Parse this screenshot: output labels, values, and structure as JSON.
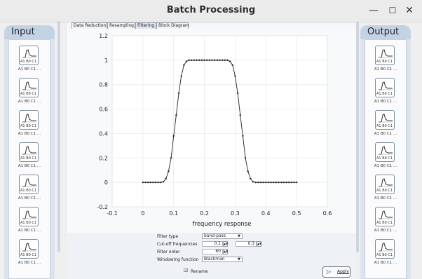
{
  "window": {
    "title": "Batch Processing",
    "minimize_glyph": "—",
    "maximize_glyph": "☐",
    "close_glyph": "✕"
  },
  "input_panel": {
    "title": "Input",
    "items": [
      {
        "icon_text": "A1 B0 C1",
        "caption": "A1 B0 C1 ..."
      },
      {
        "icon_text": "A1 B0 C1",
        "caption": "A1 B0 C1 ..."
      },
      {
        "icon_text": "A1 B0 C1",
        "caption": "A1 B0 C1 ..."
      },
      {
        "icon_text": "A1 B0 C1",
        "caption": "A1 B0 C1 ..."
      },
      {
        "icon_text": "A1 B0 C1",
        "caption": "A1 B0 C1 ..."
      },
      {
        "icon_text": "A1 B0 C1",
        "caption": "A1 B0 C1 ..."
      },
      {
        "icon_text": "A1 B0 C1",
        "caption": "A1 B0 C1 ..."
      }
    ]
  },
  "output_panel": {
    "title": "Output",
    "items": [
      {
        "icon_text": "A1 B0 C1",
        "caption": "A1 B0 C1 ..."
      },
      {
        "icon_text": "A1 B0 C1",
        "caption": "A1 B0 C1 ..."
      },
      {
        "icon_text": "A1 B0 C1",
        "caption": "A1 B0 C1 ..."
      },
      {
        "icon_text": "A1 B0 C1",
        "caption": "A1 B0 C1 ..."
      },
      {
        "icon_text": "A1 B0 C1",
        "caption": "A1 B0 C1 ..."
      },
      {
        "icon_text": "A1 B0 C1",
        "caption": "A1 B0 C1 ..."
      },
      {
        "icon_text": "A1 B0 C1",
        "caption": "A1 B0 C1 ..."
      }
    ]
  },
  "tabs": [
    {
      "label": "Data Reduction",
      "active": false
    },
    {
      "label": "Resampling",
      "active": false
    },
    {
      "label": "Filtering",
      "active": true
    },
    {
      "label": "Block Diagram",
      "active": false
    }
  ],
  "controls": {
    "filter_type_label": "Filter type",
    "filter_type_value": "band-pass",
    "cutoff_label": "Cut-off frequencies",
    "cutoff_low": "0.1",
    "cutoff_high": "0.3",
    "filter_order_label": "Filter order",
    "filter_order_value": "60",
    "windowing_label": "Windowing function",
    "windowing_value": "Blackman",
    "rename_label": "Rename",
    "rename_checked": true,
    "apply_label": "Apply"
  },
  "chart_data": {
    "type": "line",
    "title": "",
    "xlabel": "frequency response",
    "ylabel": "",
    "xlim": [
      -0.1,
      0.6
    ],
    "ylim": [
      -0.2,
      1.2
    ],
    "xticks": [
      "-0.1",
      "0",
      "0.1",
      "0.2",
      "0.3",
      "0.4",
      "0.5",
      "0.6"
    ],
    "yticks": [
      "-0.2",
      "0",
      "0.2",
      "0.4",
      "0.6",
      "0.8",
      "1",
      "1.2"
    ],
    "grid": true,
    "series": [
      {
        "markers": true,
        "x": [
          0,
          0.00833,
          0.01667,
          0.025,
          0.03333,
          0.04167,
          0.05,
          0.05833,
          0.06667,
          0.075,
          0.08333,
          0.09167,
          0.1,
          0.10833,
          0.11667,
          0.125,
          0.13333,
          0.14167,
          0.15,
          0.15833,
          0.16667,
          0.175,
          0.18333,
          0.19167,
          0.2,
          0.20833,
          0.21667,
          0.225,
          0.23333,
          0.24167,
          0.25,
          0.25833,
          0.26667,
          0.275,
          0.28333,
          0.29167,
          0.3,
          0.30833,
          0.31667,
          0.325,
          0.33333,
          0.34167,
          0.35,
          0.35833,
          0.36667,
          0.375,
          0.38333,
          0.39167,
          0.4,
          0.40833,
          0.41667,
          0.425,
          0.43333,
          0.44167,
          0.45,
          0.45833,
          0.46667,
          0.475,
          0.48333,
          0.49167,
          0.5
        ],
        "y": [
          0,
          0,
          0,
          0,
          0,
          0,
          0,
          0,
          0.005,
          0.03,
          0.09,
          0.2,
          0.38,
          0.55,
          0.73,
          0.87,
          0.96,
          0.99,
          1,
          1,
          1,
          1,
          1,
          1,
          1,
          1,
          1,
          1,
          1,
          1,
          1,
          1,
          1,
          1,
          0.99,
          0.96,
          0.87,
          0.73,
          0.55,
          0.38,
          0.2,
          0.09,
          0.03,
          0.005,
          0,
          0,
          0,
          0,
          0,
          0,
          0,
          0,
          0,
          0,
          0,
          0,
          0,
          0,
          0,
          0,
          0
        ]
      }
    ]
  },
  "colors": {
    "panel_header": "#c4d3e4",
    "plot_line": "#222222"
  },
  "icons": {
    "item_icon": "waveform-file-icon",
    "apply_icon": "apply-arrow-icon"
  }
}
